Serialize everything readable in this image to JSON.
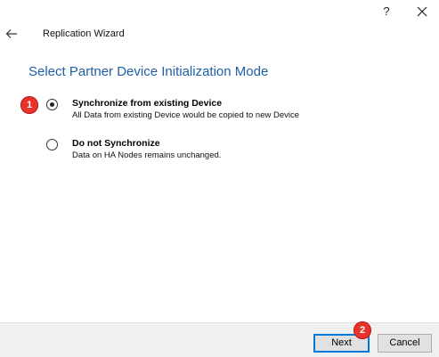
{
  "window": {
    "help_label": "?",
    "close_icon": "close-icon"
  },
  "header": {
    "back_icon": "back-arrow-icon",
    "title": "Replication Wizard"
  },
  "page": {
    "title": "Select Partner Device Initialization Mode"
  },
  "options": [
    {
      "label": "Synchronize from existing Device",
      "description": "All Data from existing Device would be copied to new Device",
      "selected": true
    },
    {
      "label": "Do not Synchronize",
      "description": "Data on HA Nodes remains unchanged.",
      "selected": false
    }
  ],
  "annotations": {
    "badge_1": "1",
    "badge_2": "2",
    "badge_color": "#e8332b"
  },
  "footer": {
    "next_label": "Next",
    "cancel_label": "Cancel"
  },
  "colors": {
    "title_blue": "#1f5fa8",
    "footer_bg": "#f0f0f0",
    "focus_border": "#0078d7"
  }
}
